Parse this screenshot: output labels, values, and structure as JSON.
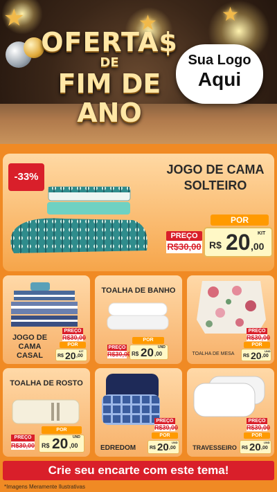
{
  "header": {
    "title_line1": "OFERTA$",
    "title_line2": "DE",
    "title_line3": "FIM DE ANO",
    "logo_line1": "Sua Logo",
    "logo_line2": "Aqui"
  },
  "featured": {
    "discount": "-33%",
    "name": "JOGO DE CAMA SOLTEIRO",
    "preco_label": "PREÇO",
    "old_price": "R$30,00",
    "por_label": "POR",
    "currency": "R$",
    "price_int": "20",
    "price_dec": ",00",
    "unit": "KIT"
  },
  "products": [
    {
      "name": "JOGO DE CAMA CASAL",
      "preco_label": "PREÇO",
      "old_price": "R$30,00",
      "por_label": "POR",
      "currency": "R$",
      "price_int": "20",
      "price_dec": ",00",
      "unit": "KIT"
    },
    {
      "name": "TOALHA DE BANHO",
      "preco_label": "PREÇO",
      "old_price": "R$30,00",
      "por_label": "POR",
      "currency": "R$",
      "price_int": "20",
      "price_dec": ",00",
      "unit": "UND"
    },
    {
      "name": "TOALHA DE MESA",
      "preco_label": "PREÇO",
      "old_price": "R$30,00",
      "por_label": "POR",
      "currency": "R$",
      "price_int": "20",
      "price_dec": ",00",
      "unit": "UND"
    },
    {
      "name": "TOALHA DE ROSTO",
      "preco_label": "PREÇO",
      "old_price": "R$30,00",
      "por_label": "POR",
      "currency": "R$",
      "price_int": "20",
      "price_dec": ",00",
      "unit": "UND"
    },
    {
      "name": "EDREDOM",
      "preco_label": "PREÇO",
      "old_price": "R$30,00",
      "por_label": "POR",
      "currency": "R$",
      "price_int": "20",
      "price_dec": ",00",
      "unit": "UND"
    },
    {
      "name": "TRAVESSEIRO",
      "preco_label": "PREÇO",
      "old_price": "R$30,00",
      "por_label": "POR",
      "currency": "R$",
      "price_int": "20",
      "price_dec": ",00",
      "unit": "UND"
    }
  ],
  "cta": "Crie seu encarte com este tema!",
  "disclaimer": "*Imagens Meramente Ilustrativas",
  "colors": {
    "accent": "#d91f2a",
    "background": "#f08a24",
    "por": "#ff9a00"
  }
}
